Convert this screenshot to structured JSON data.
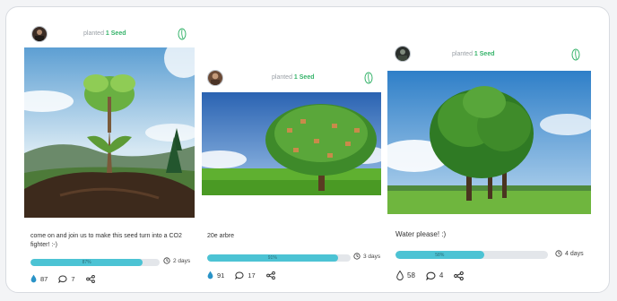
{
  "cards": [
    {
      "planted_prefix": "planted",
      "seed_text": "1 Seed",
      "caption": "come on and join us to make this seed turn into a CO2 fighter! :-)",
      "progress": 87,
      "progress_label": "87%",
      "days": "2 days",
      "drops": "87",
      "comments": "7"
    },
    {
      "planted_prefix": "planted",
      "seed_text": "1 Seed",
      "caption": "20e arbre",
      "progress": 91,
      "progress_label": "91%",
      "days": "3 days",
      "drops": "91",
      "comments": "17"
    },
    {
      "planted_prefix": "planted",
      "seed_text": "1 Seed",
      "caption": "Water please! :)",
      "progress": 58,
      "progress_label": "58%",
      "days": "4 days",
      "drops": "58",
      "comments": "4"
    }
  ],
  "colors": {
    "accent_green": "#35b36a",
    "progress_fill": "#4cc3d4",
    "drop_icon": "#2a93c7"
  }
}
